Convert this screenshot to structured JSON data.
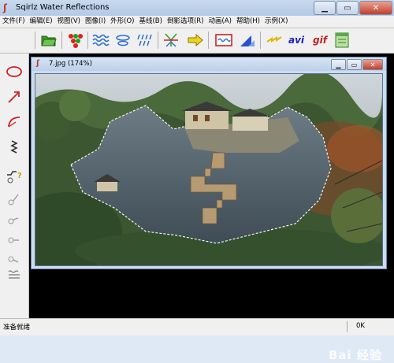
{
  "window": {
    "title": "Sqirlz Water Reflections"
  },
  "menu": [
    "文件(F)",
    "编辑(E)",
    "视图(V)",
    "图像(I)",
    "外形(O)",
    "基线(B)",
    "倒影选项(R)",
    "动画(A)",
    "帮助(H)",
    "示例(X)"
  ],
  "toolbar": {
    "avi_label": "avi",
    "gif_label": "gif"
  },
  "document": {
    "title": "7.jpg  (174%)"
  },
  "status": {
    "left": "准备就绪",
    "right": "0K"
  },
  "watermark": {
    "text": "Bai 经验"
  },
  "colors": {
    "accent": "#c0392b",
    "water": "#4b5a63",
    "foliage": "#3f5a34"
  }
}
